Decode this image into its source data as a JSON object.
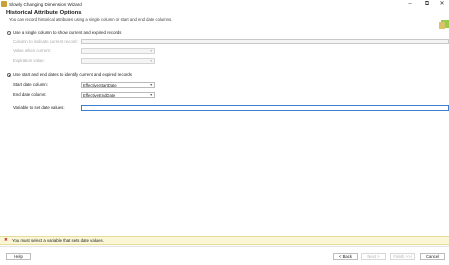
{
  "window": {
    "title": "Slowly Changing Dimension Wizard",
    "controls": {
      "minimize": "–",
      "maximize": "⧉",
      "close": "✕"
    }
  },
  "header": {
    "title": "Historical Attribute Options",
    "subtitle": "You can record historical attributes using a single column or start and end date columns."
  },
  "single_column": {
    "option_label": "Use a single column to show current and expired records",
    "selected": false,
    "column_label": "Column to indicate current record:",
    "current_label": "Value when current:",
    "expiration_label": "Expiration value:"
  },
  "date_columns": {
    "option_label": "Use start and end dates to identify current and expired records",
    "selected": true,
    "start_label": "Start date column:",
    "start_value": "EffectiveStartDate",
    "end_label": "End date column:",
    "end_value": "EffectiveEndDate",
    "variable_label": "Variable to set date values:",
    "variable_value": ""
  },
  "error": {
    "icon": "error-icon",
    "message": "You must select a variable that sets date values."
  },
  "buttons": {
    "help": "Help",
    "back": "< Back",
    "next": "Next >",
    "finish": "Finish >>|",
    "cancel": "Cancel"
  },
  "colors": {
    "error_background": "#fbf7d6",
    "focus_border": "#3c7fd1"
  }
}
